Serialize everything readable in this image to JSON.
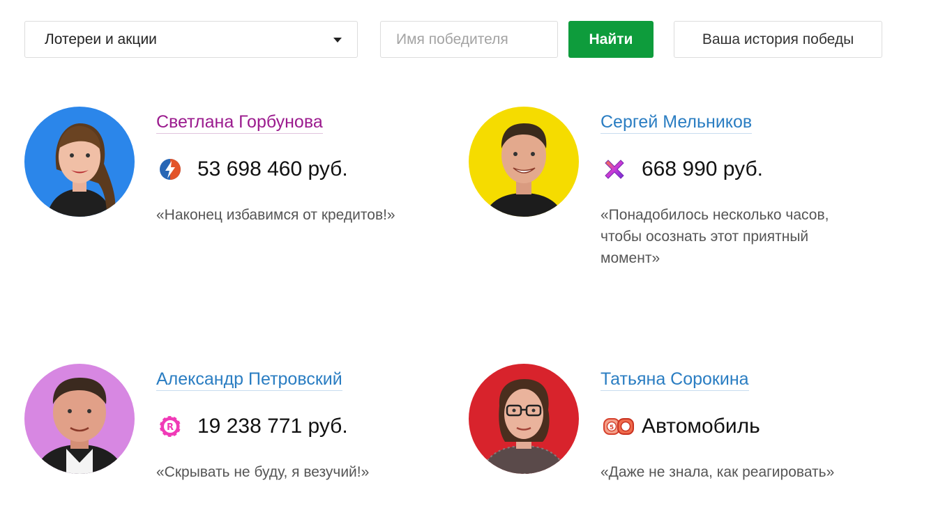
{
  "filter": {
    "select_label": "Лотереи и акции",
    "name_placeholder": "Имя победителя",
    "name_value": "",
    "find_label": "Найти",
    "history_label": "Ваша история победы"
  },
  "winners": [
    {
      "name": "Светлана Горбунова",
      "prize": "53 698 460 руб.",
      "quote": "«Наконец избавимся от кредитов!»",
      "avatar_bg": "#2b86ea",
      "lottery_icon": "lightning-ball-icon"
    },
    {
      "name": "Сергей Мельников",
      "prize": "668 990 руб.",
      "quote": "«Понадобилось несколько часов, чтобы осознать этот приятный момент»",
      "avatar_bg": "#f5dc00",
      "lottery_icon": "purple-cross-icon"
    },
    {
      "name": "Александр Петровский",
      "prize": "19 238 771 руб.",
      "quote": "«Скрывать не буду, я везучий!»",
      "avatar_bg": "#d787e2",
      "lottery_icon": "pink-r-chip-icon"
    },
    {
      "name": "Татьяна Сорокина",
      "prize": "Автомобиль",
      "quote": "«Даже не знала, как реагировать»",
      "avatar_bg": "#d8232c",
      "lottery_icon": "bingo-barrels-icon"
    }
  ],
  "colors": {
    "accent_green": "#0e9c3c",
    "link_blue": "#2a7dc2",
    "link_visited": "#9b1b8e"
  }
}
